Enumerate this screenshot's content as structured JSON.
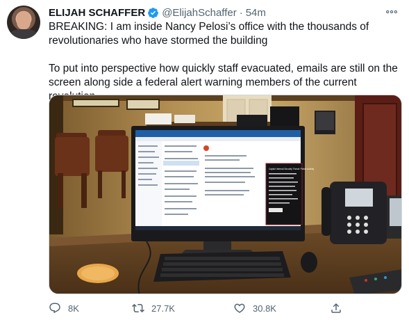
{
  "author": {
    "name": "ELIJAH SCHAFFER",
    "handle": "@ElijahSchaffer",
    "separator": "·",
    "time": "54m",
    "verified": true
  },
  "tweet": {
    "paragraph1": "BREAKING: I am inside Nancy Pelosi’s office with the thousands of revolutionaries who have stormed the building",
    "paragraph2": "To put into perspective how quickly staff evacuated, emails are still on the screen along side a federal alert warning members of the current revolution"
  },
  "media": {
    "alert_title": "Capitol Internal Security Threat: Police Activity"
  },
  "actions": {
    "reply_count": "8K",
    "retweet_count": "27.7K",
    "like_count": "30.8K"
  },
  "icons": {
    "more": "more-horizontal-icon",
    "reply": "reply-icon",
    "retweet": "retweet-icon",
    "like": "heart-icon",
    "share": "share-icon"
  },
  "colors": {
    "verified": "#1d9bf0",
    "secondary_text": "#536471",
    "primary_text": "#0f1419"
  }
}
